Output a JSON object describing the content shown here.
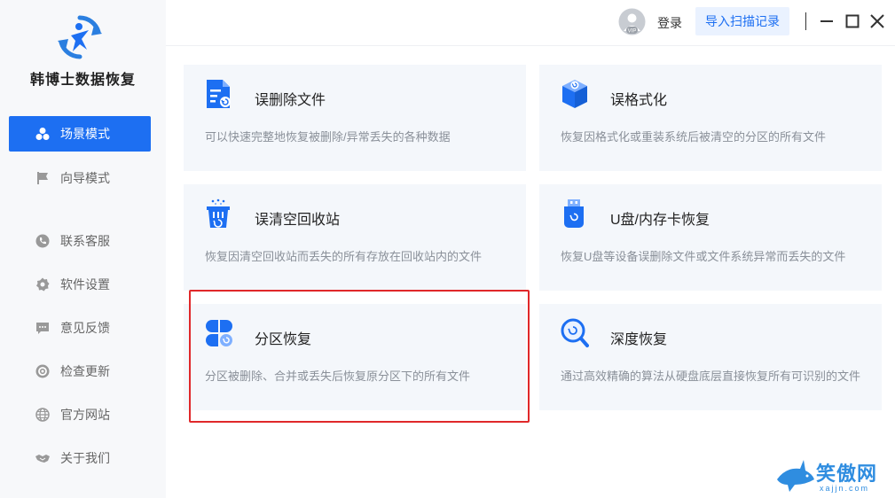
{
  "app": {
    "title": "韩博士数据恢复"
  },
  "sidebar": {
    "items": [
      {
        "label": "场景模式",
        "icon": "scene-icon",
        "active": true
      },
      {
        "label": "向导模式",
        "icon": "flag-icon",
        "active": false
      },
      {
        "label": "联系客服",
        "icon": "phone-icon",
        "active": false
      },
      {
        "label": "软件设置",
        "icon": "gear-icon",
        "active": false
      },
      {
        "label": "意见反馈",
        "icon": "message-icon",
        "active": false
      },
      {
        "label": "检查更新",
        "icon": "refresh-icon",
        "active": false
      },
      {
        "label": "官方网站",
        "icon": "globe-icon",
        "active": false
      },
      {
        "label": "关于我们",
        "icon": "handshake-icon",
        "active": false
      }
    ]
  },
  "topbar": {
    "avatar_badge": "VIP",
    "login_label": "登录",
    "import_label": "导入扫描记录"
  },
  "cards": [
    {
      "title": "误删除文件",
      "desc": "可以快速完整地恢复被删除/异常丢失的各种数据",
      "icon": "document-restore-icon"
    },
    {
      "title": "误格式化",
      "desc": "恢复因格式化或重装系统后被清空的分区的所有文件",
      "icon": "cube-restore-icon"
    },
    {
      "title": "误清空回收站",
      "desc": "恢复因清空回收站而丢失的所有存放在回收站内的文件",
      "icon": "recycle-bin-icon"
    },
    {
      "title": "U盘/内存卡恢复",
      "desc": "恢复U盘等设备误删除文件或文件系统异常而丢失的文件",
      "icon": "usb-drive-icon"
    },
    {
      "title": "分区恢复",
      "desc": "分区被删除、合并或丢失后恢复原分区下的所有文件",
      "icon": "partition-icon"
    },
    {
      "title": "深度恢复",
      "desc": "通过高效精确的算法从硬盘底层直接恢复所有可识别的文件",
      "icon": "magnifier-icon"
    }
  ],
  "watermark": {
    "text": "笑傲网",
    "url": "xajjn.com"
  },
  "colors": {
    "accent": "#1d6ff2",
    "highlight": "#e0282a",
    "card_bg": "#f4f7fb"
  }
}
